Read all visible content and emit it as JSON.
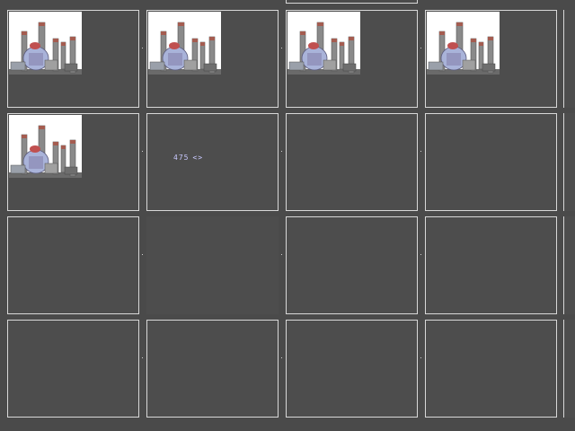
{
  "background_color": "#4a4a4a",
  "cell_color": "#4d4d4d",
  "border_color": "#d8d8d8",
  "readout": {
    "value": "475",
    "arrows": "<>",
    "color": "#c9c9ff"
  },
  "grid": {
    "rows": 4,
    "columns": 4,
    "thumbnail_icon": "industrial-towers-icon",
    "cells": [
      {
        "row": 1,
        "col": 1,
        "has_thumbnail": true,
        "bordered": true
      },
      {
        "row": 1,
        "col": 2,
        "has_thumbnail": true,
        "bordered": true
      },
      {
        "row": 1,
        "col": 3,
        "has_thumbnail": true,
        "bordered": true
      },
      {
        "row": 1,
        "col": 4,
        "has_thumbnail": true,
        "bordered": true
      },
      {
        "row": 2,
        "col": 1,
        "has_thumbnail": true,
        "bordered": true
      },
      {
        "row": 2,
        "col": 2,
        "has_thumbnail": false,
        "bordered": true
      },
      {
        "row": 2,
        "col": 3,
        "has_thumbnail": false,
        "bordered": true
      },
      {
        "row": 2,
        "col": 4,
        "has_thumbnail": false,
        "bordered": true
      },
      {
        "row": 3,
        "col": 1,
        "has_thumbnail": false,
        "bordered": true
      },
      {
        "row": 3,
        "col": 2,
        "has_thumbnail": false,
        "bordered": false
      },
      {
        "row": 3,
        "col": 3,
        "has_thumbnail": false,
        "bordered": true
      },
      {
        "row": 3,
        "col": 4,
        "has_thumbnail": false,
        "bordered": true
      },
      {
        "row": 4,
        "col": 1,
        "has_thumbnail": false,
        "bordered": true
      },
      {
        "row": 4,
        "col": 2,
        "has_thumbnail": false,
        "bordered": true
      },
      {
        "row": 4,
        "col": 3,
        "has_thumbnail": false,
        "bordered": true
      },
      {
        "row": 4,
        "col": 4,
        "has_thumbnail": false,
        "bordered": true
      }
    ]
  }
}
